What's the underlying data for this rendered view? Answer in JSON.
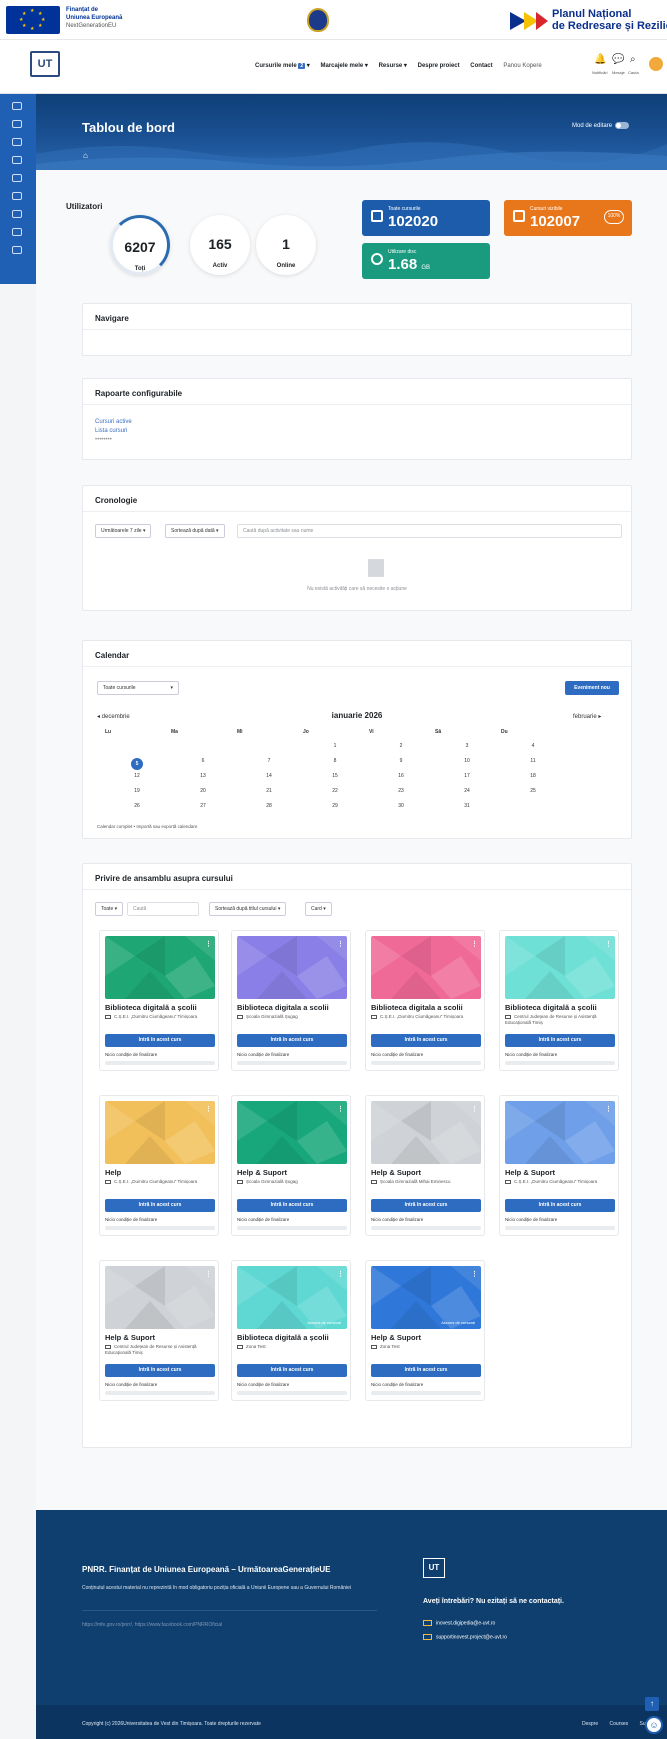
{
  "topbar": {
    "eu_line1": "Finanțat de",
    "eu_line2": "Uniunea Europeană",
    "eu_line3": "NextGenerationEU",
    "pnrr_line1": "Planul Național",
    "pnrr_line2": "de Redresare și Reziliență"
  },
  "navbar": {
    "logo": "UT",
    "links": [
      "Cursurile mele",
      "Marcajele mele",
      "Resurse",
      "Despre proiect",
      "Contact",
      "Panou Kopere"
    ],
    "mycourses_badge": "2",
    "notif_label": "Notificări",
    "msg_label": "Mesaje",
    "grid_label": "Cauta"
  },
  "dashboard": {
    "title": "Tablou de bord",
    "home_glyph": "⌂",
    "edit_mode": "Mod de editare"
  },
  "users": {
    "title": "Utilizatori",
    "total": "6207",
    "total_label": "Toți",
    "active": "165",
    "active_label": "Activ",
    "online": "1",
    "online_label": "Online"
  },
  "stats": {
    "all_courses_label": "Toate cursurile",
    "all_courses_value": "102020",
    "visible_label": "Cursuri vizibile",
    "visible_value": "102007",
    "visible_pct": "100%",
    "disk_label": "Utilizare disc",
    "disk_value": "1.68",
    "disk_unit": "GB"
  },
  "navigation": {
    "title": "Navigare"
  },
  "reports": {
    "title": "Rapoarte configurabile",
    "link1": "Cursuri active",
    "link2": "Lista cursuri",
    "link3": "••••••••"
  },
  "timeline": {
    "title": "Cronologie",
    "filter": "Următoarele 7 zile",
    "sort": "Sortează după dată",
    "search_placeholder": "Caută după activitate sau nume",
    "empty": "Nu există activități care să necesite o acțiune"
  },
  "calendar": {
    "title": "Calendar",
    "course_filter": "Toate cursurile",
    "new_event": "Eveniment nou",
    "prev": "◂ decembrie",
    "month": "ianuarie 2026",
    "next": "februarie ▸",
    "days": [
      "Lu",
      "Ma",
      "Mi",
      "Jo",
      "Vi",
      "Sâ",
      "Du"
    ],
    "weeks": [
      [
        "",
        "",
        "",
        "1",
        "2",
        "3",
        "4"
      ],
      [
        "5",
        "6",
        "7",
        "8",
        "9",
        "10",
        "11"
      ],
      [
        "12",
        "13",
        "14",
        "15",
        "16",
        "17",
        "18"
      ],
      [
        "19",
        "20",
        "21",
        "22",
        "23",
        "24",
        "25"
      ],
      [
        "26",
        "27",
        "28",
        "29",
        "30",
        "31",
        ""
      ]
    ],
    "today": "5",
    "footer": "Calendar complet • Importă sau exportă calendare"
  },
  "courses": {
    "title": "Privire de ansamblu asupra cursului",
    "filter": "Toate",
    "search_placeholder": "Caută",
    "sort": "Sortează după titlul cursului",
    "view": "Card",
    "enter": "Intră în acest curs",
    "no_completion": "Nicio condiție de finalizare",
    "hidden_label": "Ascuns de cursanți",
    "items": [
      {
        "name": "Biblioteca digitală a școlii",
        "category": "C.Ș.E.I. „Dumitru Ciumăgeanu\" Timișoara",
        "color": "#1ea774"
      },
      {
        "name": "Biblioteca digitala a scolii",
        "category": "Școala Gimnazială Șugag",
        "color": "#8a7fe6"
      },
      {
        "name": "Biblioteca digitala a scolii",
        "category": "C.Ș.E.I. „Dumitru Ciumăgeanu\" Timișoara",
        "color": "#f06a98"
      },
      {
        "name": "Biblioteca digitală a școlii",
        "category": "Centrul Județean de Resurse și Asistență Educațională Timiș",
        "color": "#6fe0d6"
      },
      {
        "name": "Help",
        "category": "C.Ș.E.I. „Dumitru Ciumăgeanu\" Timișoara",
        "color": "#f2c05a"
      },
      {
        "name": "Help & Suport",
        "category": "Școala Gimnazială Șugag",
        "color": "#17a77a"
      },
      {
        "name": "Help & Suport",
        "category": "Școala Gimnazială Mihai Eminescu",
        "color": "#cfd3d7"
      },
      {
        "name": "Help & Suport",
        "category": "C.Ș.E.I. „Dumitru Ciumăgeanu\" Timișoara",
        "color": "#6e9fe8"
      },
      {
        "name": "Help & Suport",
        "category": "Centrul Județean de Resurse și Asistență Educațională Timiș",
        "color": "#cfd2d6"
      },
      {
        "name": "Biblioteca digitală a școlii",
        "category": "Zona Test",
        "color": "#5fd8d3"
      },
      {
        "name": "Help & Suport",
        "category": "Zona Test",
        "color": "#2f78d9"
      }
    ]
  },
  "footer": {
    "title": "PNRR. Finanțat de Uniunea Europeană – UrmătoareaGenerațieUE",
    "text": "Conținutul acestui material nu reprezintă în mod obligatoriu poziția oficială a Uniunii Europene sau a Guvernului României",
    "links": "https://mfe.gov.ro/pnrr/, https://www.facebook.com/PNRROficial",
    "logo": "UT",
    "question": "Aveți întrebări? Nu ezitați să ne contactați.",
    "email1": "inovest.digipedia@e-uvt.ro",
    "email2": "supportinovest.project@e-uvt.ro",
    "copyright": "Copyright (c) 2026Universitatea de Vest din Timișoara. Toate drepturile rezervate",
    "nav": [
      "Despre",
      "Courses",
      "Support"
    ]
  }
}
